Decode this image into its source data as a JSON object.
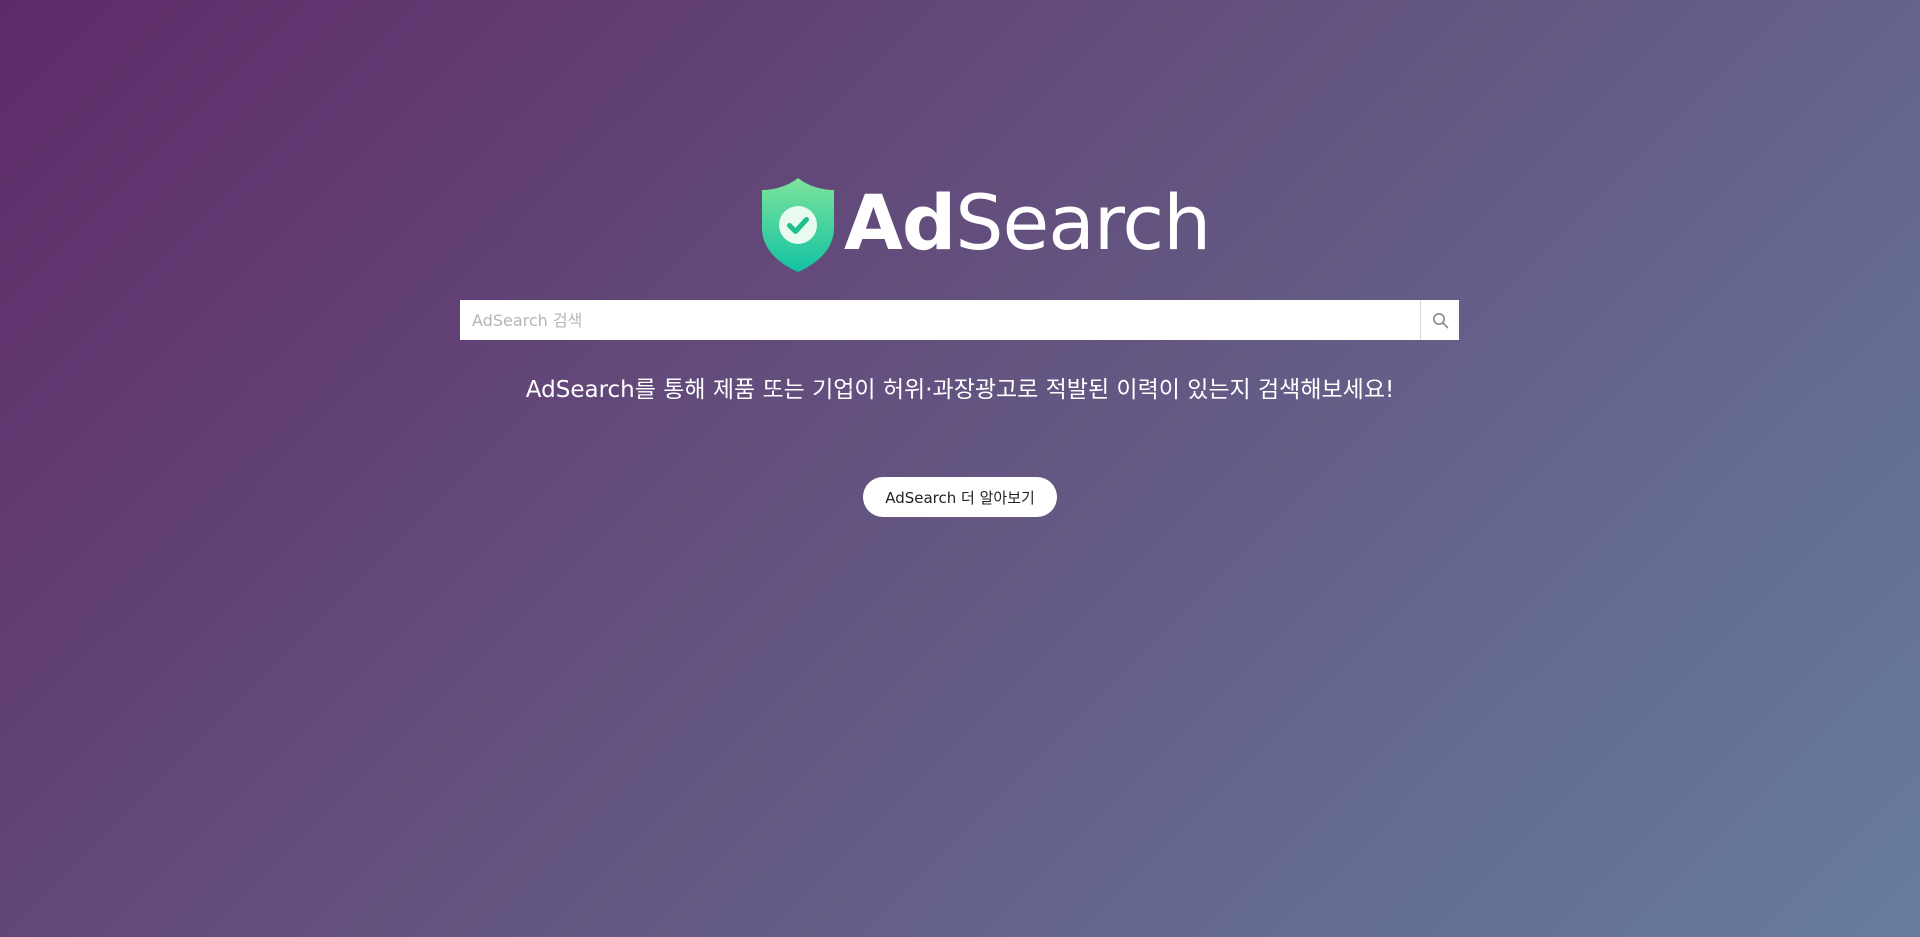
{
  "logo": {
    "bold_text": "Ad",
    "light_text": "Search",
    "icon": "shield-check-icon",
    "icon_colors": [
      "#7de39b",
      "#12c2a3"
    ]
  },
  "search": {
    "placeholder": "AdSearch 검색",
    "value": "",
    "button_icon": "search-icon"
  },
  "tagline": "AdSearch를 통해 제품 또는 기업이 허위·과장광고로 적발된 이력이 있는지 검색해보세요!",
  "learn_more_button": "AdSearch 더 알아보기",
  "colors": {
    "background_start": "#5f2a68",
    "background_end": "#667d9e"
  }
}
